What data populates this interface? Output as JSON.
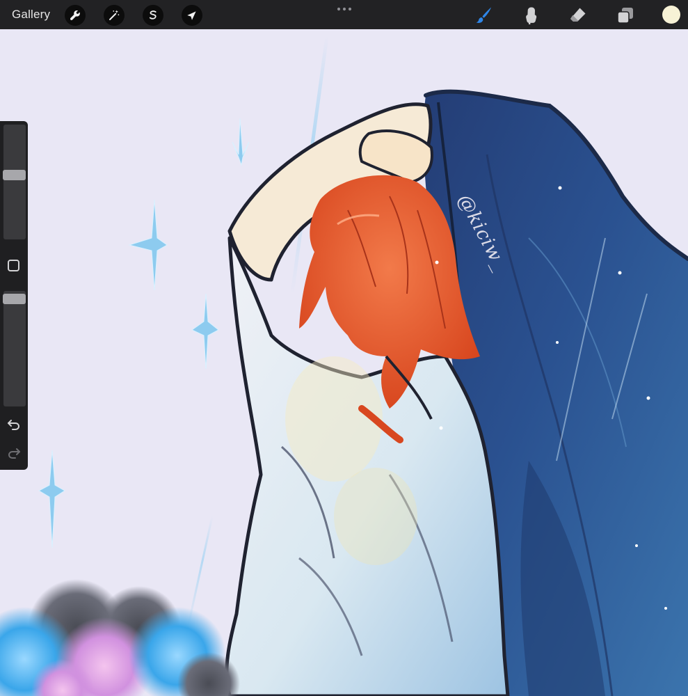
{
  "toolbar": {
    "gallery_label": "Gallery",
    "left_tools": [
      {
        "icon": "wrench-icon",
        "name": "actions"
      },
      {
        "icon": "magic-wand-icon",
        "name": "adjustments"
      },
      {
        "icon": "selection-s-icon",
        "name": "selection"
      },
      {
        "icon": "transform-arrow-icon",
        "name": "transform"
      }
    ],
    "center_menu_icon": "more-dots-icon",
    "right_tools": [
      {
        "icon": "brush-icon",
        "name": "paint",
        "active": true
      },
      {
        "icon": "smudge-icon",
        "name": "smudge",
        "active": false
      },
      {
        "icon": "eraser-icon",
        "name": "erase",
        "active": false
      },
      {
        "icon": "layers-icon",
        "name": "layers",
        "active": false
      }
    ],
    "current_color": "#f7f2d6",
    "active_tool_color": "#2f86e8"
  },
  "sidebar": {
    "brush_size_icon": "brush-size-slider",
    "opacity_icon": "opacity-slider",
    "modify_icon": "square-modify-icon",
    "undo_icon": "undo-arrow-icon",
    "redo_icon": "redo-arrow-icon"
  },
  "canvas": {
    "watermark": "@kiciw_",
    "colors": {
      "background": "#e9e7f5",
      "hair": "#e65c2c",
      "shirt": "#dfe6ef",
      "jacket": "#2a4c84",
      "skin": "#f6e6cf",
      "sparkle": "#7fc6ec",
      "flowers_blue": "#52b0ec",
      "flowers_pink": "#dca0e0"
    }
  }
}
